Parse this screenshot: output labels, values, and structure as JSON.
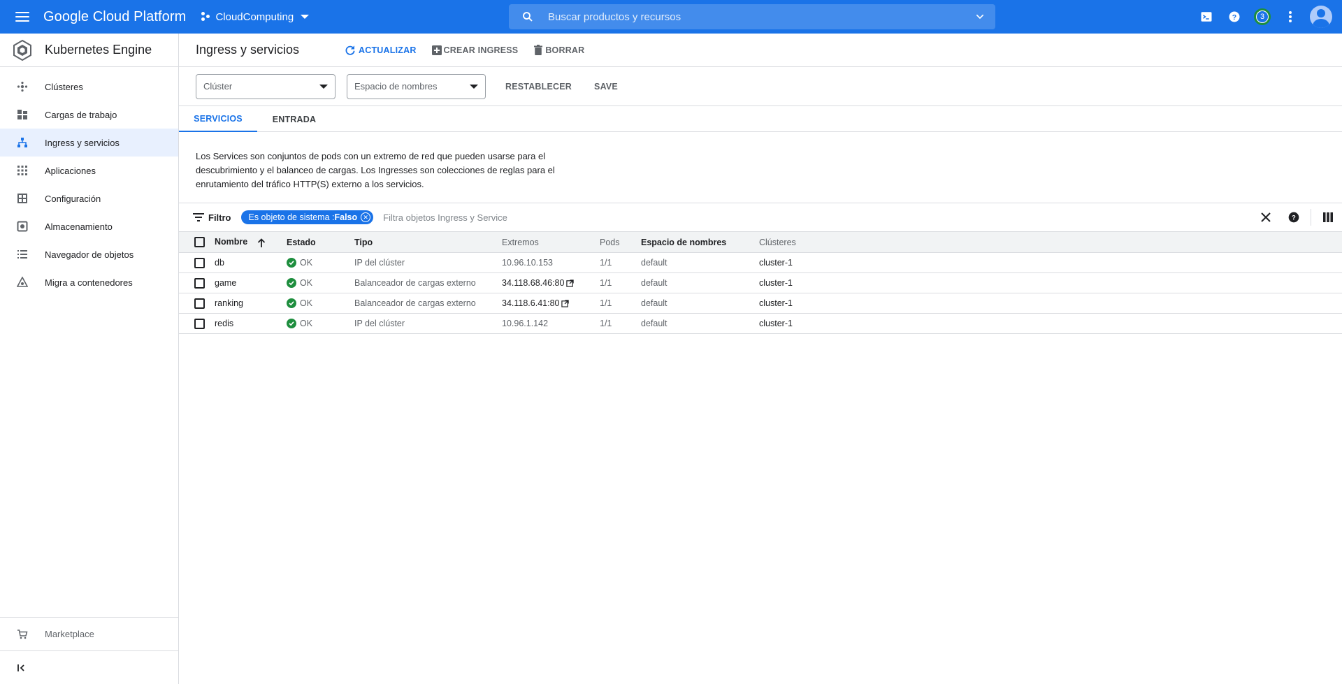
{
  "topbar": {
    "brand": "Google Cloud Platform",
    "project": "CloudComputing",
    "search_placeholder": "Buscar productos y recursos",
    "notification_count": "3"
  },
  "sidebar": {
    "product": "Kubernetes Engine",
    "items": [
      {
        "label": "Clústeres",
        "icon": "clusters-icon"
      },
      {
        "label": "Cargas de trabajo",
        "icon": "workloads-icon"
      },
      {
        "label": "Ingress y servicios",
        "icon": "services-icon",
        "active": true
      },
      {
        "label": "Aplicaciones",
        "icon": "apps-grid-icon"
      },
      {
        "label": "Configuración",
        "icon": "config-icon"
      },
      {
        "label": "Almacenamiento",
        "icon": "storage-icon"
      },
      {
        "label": "Navegador de objetos",
        "icon": "object-browser-icon"
      },
      {
        "label": "Migra a contenedores",
        "icon": "migrate-icon"
      }
    ],
    "marketplace": "Marketplace"
  },
  "page": {
    "title": "Ingress y servicios",
    "actions": {
      "refresh": "ACTUALIZAR",
      "create_ingress": "CREAR INGRESS",
      "delete": "BORRAR"
    },
    "filters": {
      "cluster_placeholder": "Clúster",
      "namespace_placeholder": "Espacio de nombres",
      "reset": "RESTABLECER",
      "save": "SAVE"
    },
    "tabs": [
      {
        "label": "SERVICIOS",
        "active": true
      },
      {
        "label": "ENTRADA",
        "active": false
      }
    ],
    "description": "Los Services son conjuntos de pods con un extremo de red que pueden usarse para el descubrimiento y el balanceo de cargas. Los Ingresses son colecciones de reglas para el enrutamiento del tráfico HTTP(S) externo a los servicios."
  },
  "table_toolbar": {
    "filter_label": "Filtro",
    "chip_key": "Es objeto de sistema : ",
    "chip_value": "Falso",
    "filter_placeholder": "Filtra objetos Ingress y Service"
  },
  "table": {
    "headers": {
      "name": "Nombre",
      "status": "Estado",
      "type": "Tipo",
      "endpoints": "Extremos",
      "pods": "Pods",
      "namespace": "Espacio de nombres",
      "clusters": "Clústeres"
    },
    "rows": [
      {
        "name": "db",
        "status": "OK",
        "type": "IP del clúster",
        "endpoints": "10.96.10.153",
        "external": false,
        "pods": "1/1",
        "namespace": "default",
        "cluster": "cluster-1"
      },
      {
        "name": "game",
        "status": "OK",
        "type": "Balanceador de cargas externo",
        "endpoints": "34.118.68.46:80",
        "external": true,
        "pods": "1/1",
        "namespace": "default",
        "cluster": "cluster-1"
      },
      {
        "name": "ranking",
        "status": "OK",
        "type": "Balanceador de cargas externo",
        "endpoints": "34.118.6.41:80",
        "external": true,
        "pods": "1/1",
        "namespace": "default",
        "cluster": "cluster-1"
      },
      {
        "name": "redis",
        "status": "OK",
        "type": "IP del clúster",
        "endpoints": "10.96.1.142",
        "external": false,
        "pods": "1/1",
        "namespace": "default",
        "cluster": "cluster-1"
      }
    ]
  },
  "colors": {
    "brand_blue": "#1a73e8",
    "ok_green": "#1e8e3e",
    "active_nav_bg": "#e8f0fe"
  }
}
